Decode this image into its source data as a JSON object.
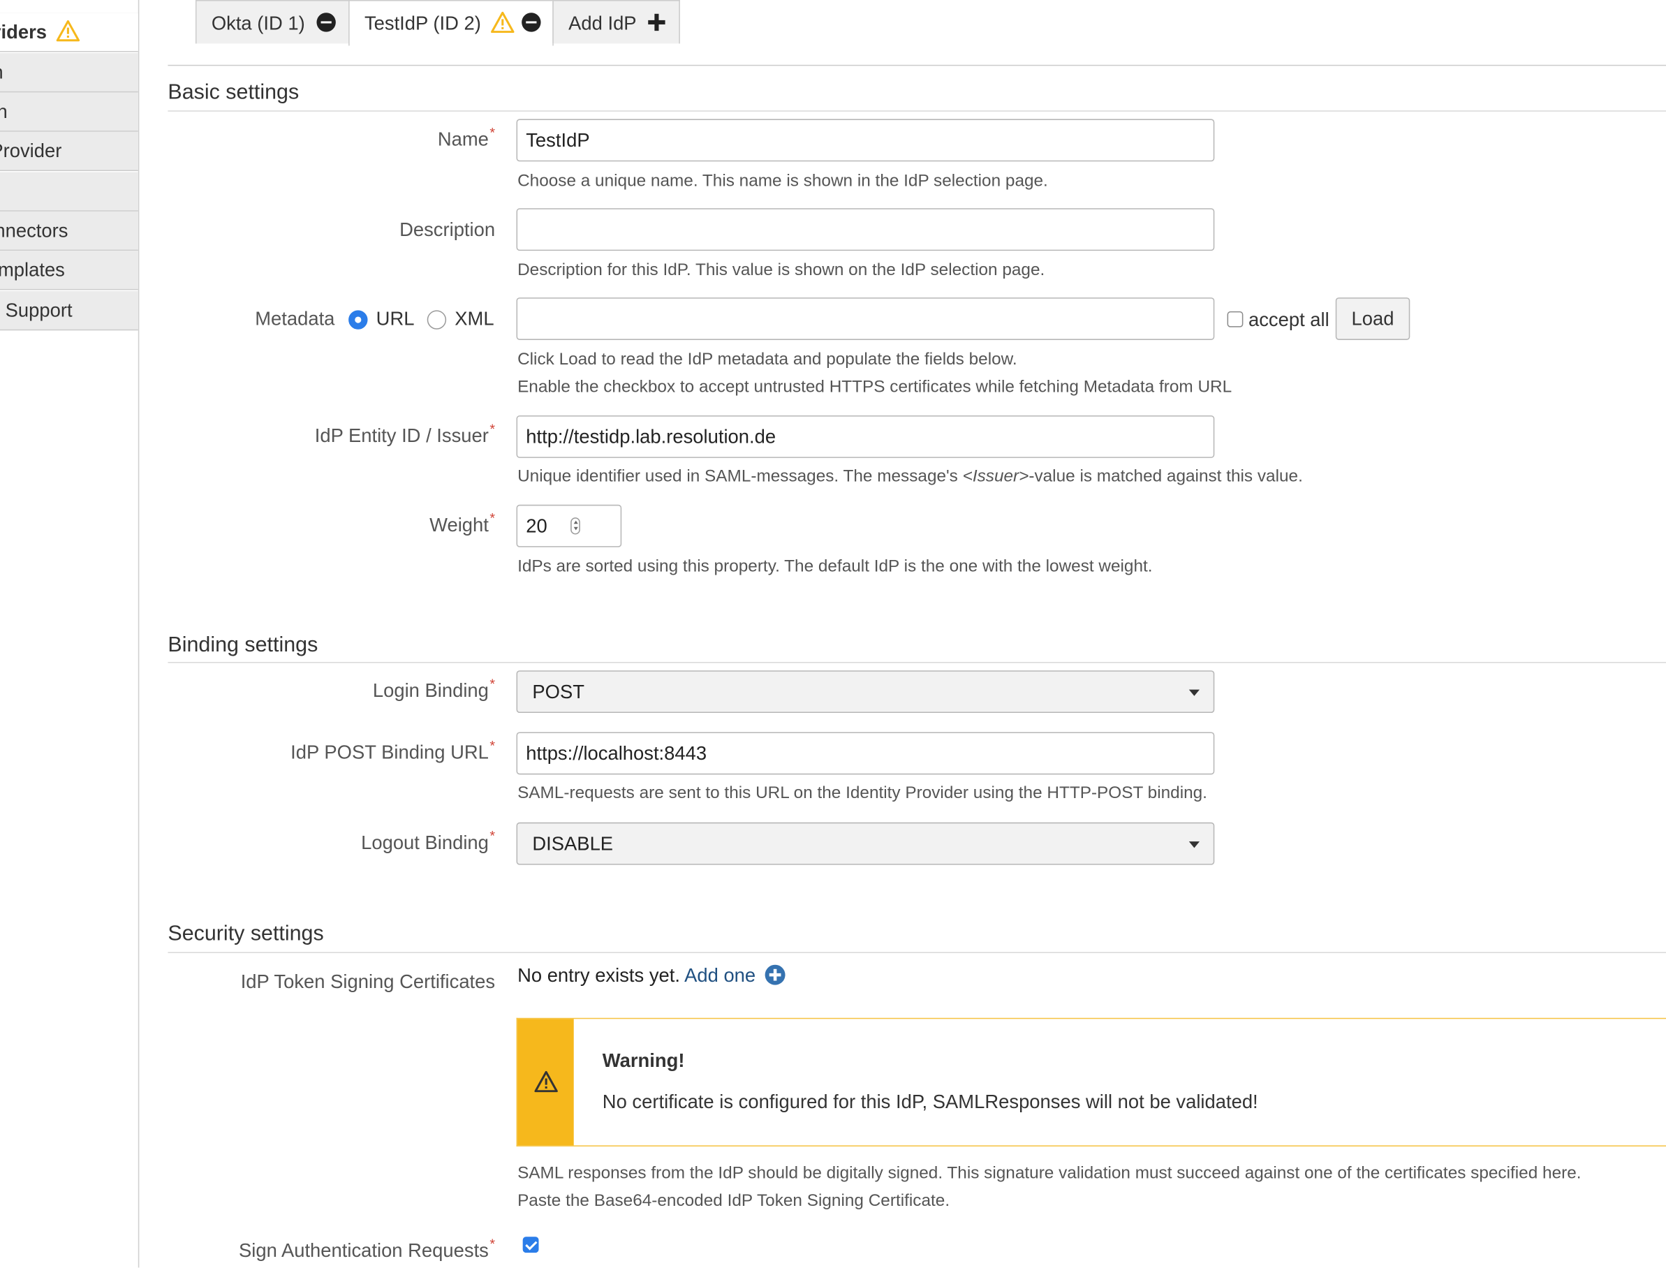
{
  "sidebar": {
    "items": [
      {
        "label": "Identity Providers"
      },
      {
        "label": "User Creation"
      },
      {
        "label": "Redirection"
      },
      {
        "label": "Service Provider"
      },
      {
        "label": ""
      },
      {
        "label": "Connectors"
      },
      {
        "label": "Templates"
      },
      {
        "label": "Get Support"
      }
    ]
  },
  "tabs": [
    {
      "label": "Okta (ID 1)"
    },
    {
      "label": "TestIdP (ID 2)"
    },
    {
      "label": "Add IdP"
    }
  ],
  "basic": {
    "heading": "Basic settings",
    "name_label": "Name",
    "name_value": "TestIdP",
    "name_help": "Choose a unique name. This name is shown in the IdP selection page.",
    "desc_label": "Description",
    "desc_value": "",
    "desc_help": "Description for this IdP. This value is shown on the IdP selection page.",
    "metadata_label": "Metadata",
    "radio_url": "URL",
    "radio_xml": "XML",
    "metadata_value": "",
    "accept_all": "accept all",
    "load_button": "Load",
    "metadata_help1": "Click Load to read the IdP metadata and populate the fields below.",
    "metadata_help2": "Enable the checkbox to accept untrusted HTTPS certificates while fetching Metadata from URL",
    "entity_label": "IdP Entity ID / Issuer",
    "entity_value": "http://testidp.lab.resolution.de",
    "entity_help_a": "Unique identifier used in SAML-messages. The message's ",
    "entity_help_b": "<Issuer>",
    "entity_help_c": "-value is matched against this value.",
    "weight_label": "Weight",
    "weight_value": "20",
    "weight_help": "IdPs are sorted using this property. The default IdP is the one with the lowest weight."
  },
  "binding": {
    "heading": "Binding settings",
    "login_label": "Login Binding",
    "login_value": "POST",
    "post_url_label": "IdP POST Binding URL",
    "post_url_value": "https://localhost:8443",
    "post_url_help": "SAML-requests are sent to this URL on the Identity Provider using the HTTP-POST binding.",
    "logout_label": "Logout Binding",
    "logout_value": "DISABLE"
  },
  "security": {
    "heading": "Security settings",
    "cert_label": "IdP Token Signing Certificates",
    "no_entry": "No entry exists yet.",
    "add_one": "Add one",
    "warning_title": "Warning!",
    "warning_msg": "No certificate is configured for this IdP, SAMLResponses will not be validated!",
    "cert_help1": "SAML responses from the IdP should be digitally signed. This signature validation must succeed against one of the certificates specified here.",
    "cert_help2": "Paste the Base64-encoded IdP Token Signing Certificate.",
    "sign_label": "Sign Authentication Requests"
  },
  "colors": {
    "accent": "#2b7de9",
    "warning": "#f6b81c",
    "link": "#205081",
    "required": "#d04437"
  }
}
